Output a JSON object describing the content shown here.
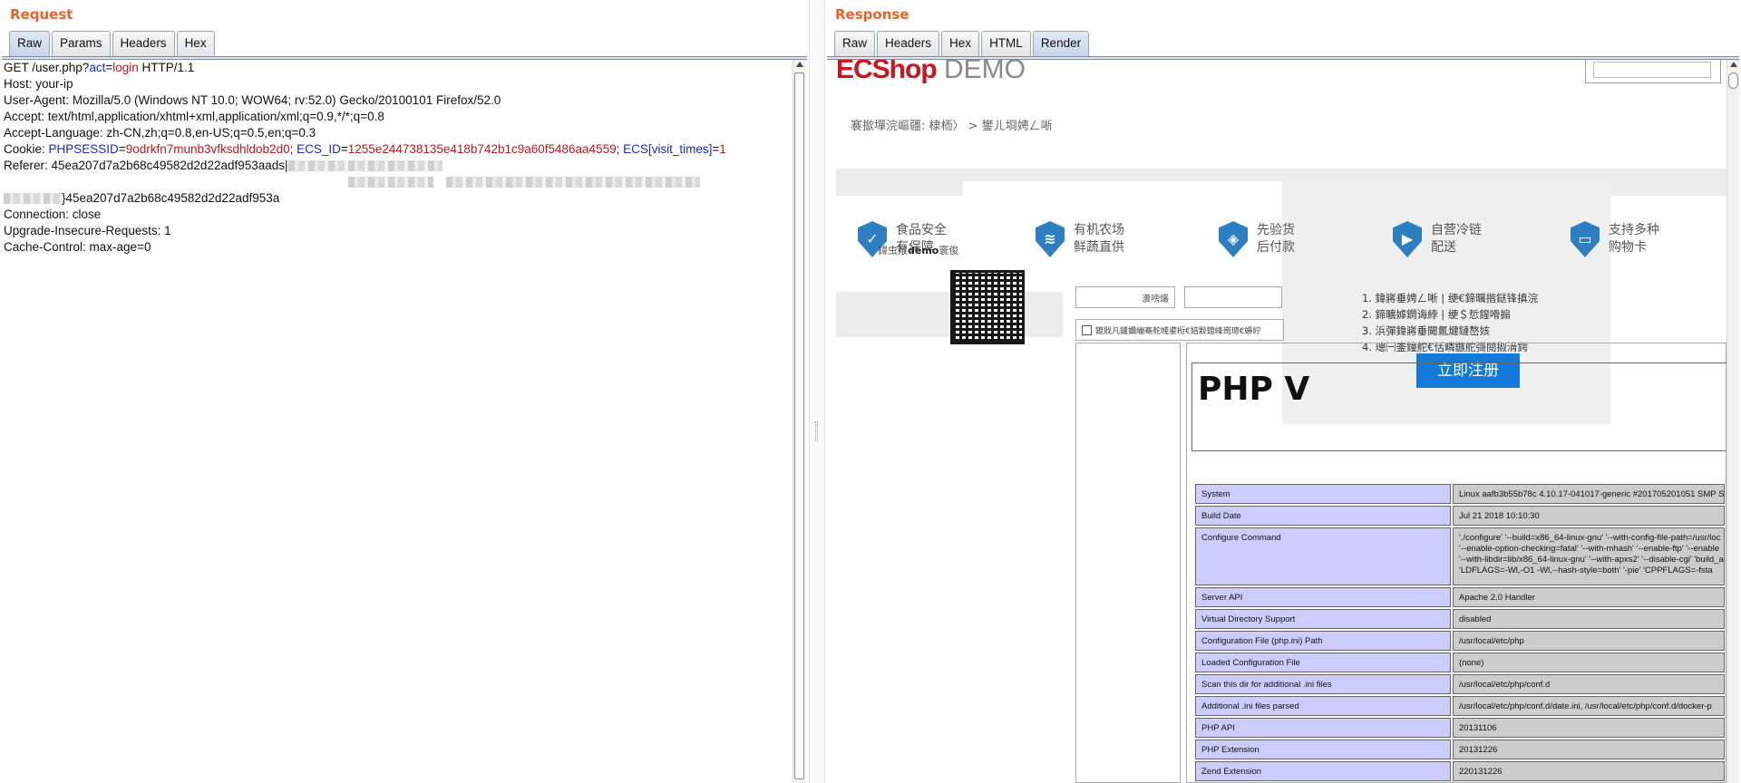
{
  "request": {
    "title": "Request",
    "tabs": [
      "Raw",
      "Params",
      "Headers",
      "Hex"
    ],
    "active_tab": "Raw",
    "line1": {
      "a": "GET /user.php?",
      "k": "act",
      "eq": "=",
      "v": "login",
      "b": " HTTP/1.1"
    },
    "host": "Host: your-ip",
    "user_agent": "User-Agent: Mozilla/5.0 (Windows NT 10.0; WOW64; rv:52.0) Gecko/20100101 Firefox/52.0",
    "accept": "Accept: text/html,application/xhtml+xml,application/xml;q=0.9,*/*;q=0.8",
    "accept_language": "Accept-Language: zh-CN,zh;q=0.8,en-US;q=0.5,en;q=0.3",
    "cookie": {
      "label": "Cookie: ",
      "k1": "PHPSESSID",
      "v1": "9odrkfn7munb3vfksdhldob2d0",
      "k2": "ECS_ID",
      "v2": "1255e244738135e418b742b1c9a60f5486aa4559",
      "k3": "ECS[visit_times]",
      "v3": "1"
    },
    "referer": "Referer: 45ea207d7a2b68c49582d2d22adf953aads|",
    "referer_tail": "}45ea207d7a2b68c49582d2d22adf953a",
    "connection": "Connection: close",
    "upgrade": "Upgrade-Insecure-Requests: 1",
    "cache_control": "Cache-Control: max-age=0"
  },
  "response": {
    "title": "Response",
    "tabs": [
      "Raw",
      "Headers",
      "Hex",
      "HTML",
      "Render"
    ],
    "active_tab": "Render",
    "logo_main": "ECShop",
    "logo_demo": " DEMO",
    "breadcrumb": "褰撳墠浣嶇疆: 棣栭〉 > 鐢ㄦ埛娉ㄥ唽",
    "features": [
      {
        "icon": "shield-check-icon",
        "line1": "食品安全",
        "line2": "有保障"
      },
      {
        "icon": "shield-leaf-icon",
        "line1": "有机农场",
        "line2": "鲜蔬直供"
      },
      {
        "icon": "shield-box-icon",
        "line1": "先验货",
        "line2": "后付款"
      },
      {
        "icon": "shield-truck-icon",
        "line1": "自营冷链",
        "line2": "配送"
      },
      {
        "icon": "shield-card-icon",
        "line1": "支持多种",
        "line2": "购物卡"
      }
    ],
    "qr_label_prefix": "鍏虫敞",
    "qr_label_bold": "demo",
    "qr_label_suffix": "寰俊",
    "form_label": "瀵嗙爜",
    "checkbox_text": "鎴戝凡鐪嬭繃骞舵帴鍙椼€婄敤鎴峰崗璁€嬶紵",
    "steps": [
      "1. 鍏嶈垂娉ㄥ唽 | 绠€鍗曞揩鎹锋搷浣",
      "2. 鍗曠嫭鐧诲綍 | 绠＄悊鍟嗗搧",
      "3. 浜彈鍏嶈垂閫氱煡鏈嶅姟",
      "4. 璁㈠崟鐘舵€佸疄鏃舵彁閱掓湇鍔"
    ],
    "register_button": "立即注册",
    "php_heading": "PHP V",
    "php_rows": [
      {
        "k": "System",
        "v": [
          "Linux aafb3b55b78c 4.10.17-041017-generic #201705201051 SMP S"
        ]
      },
      {
        "k": "Build Date",
        "v": [
          "Jul 21 2018 10:10:30"
        ]
      },
      {
        "k": "Configure Command",
        "v": [
          "'./configure' '--build=x86_64-linux-gnu' '--with-config-file-path=/usr/loc",
          "'--enable-option-checking=fatal' '--with-mhash' '--enable-ftp' '--enable",
          "'--with-libdir=lib/x86_64-linux-gnu' '--with-apxs2' '--disable-cgi' 'build_a",
          "'LDFLAGS=-Wl,-O1 -Wl,--hash-style=both' '-pie' 'CPPFLAGS=-fsta"
        ]
      },
      {
        "k": "Server API",
        "v": [
          "Apache 2.0 Handler"
        ]
      },
      {
        "k": "Virtual Directory Support",
        "v": [
          "disabled"
        ]
      },
      {
        "k": "Configuration File (php.ini) Path",
        "v": [
          "/usr/local/etc/php"
        ]
      },
      {
        "k": "Loaded Configuration File",
        "v": [
          "(none)"
        ]
      },
      {
        "k": "Scan this dir for additional .ini files",
        "v": [
          "/usr/local/etc/php/conf.d"
        ]
      },
      {
        "k": "Additional .ini files parsed",
        "v": [
          "/usr/local/etc/php/conf.d/date.ini, /usr/local/etc/php/conf.d/docker-p"
        ]
      },
      {
        "k": "PHP API",
        "v": [
          "20131106"
        ]
      },
      {
        "k": "PHP Extension",
        "v": [
          "20131226"
        ]
      },
      {
        "k": "Zend Extension",
        "v": [
          "220131226"
        ]
      }
    ]
  },
  "colors": {
    "accent": "#e8642c",
    "param_key": "#1b2cb3",
    "param_value": "#b31b1b",
    "register_button": "#1479d8"
  }
}
